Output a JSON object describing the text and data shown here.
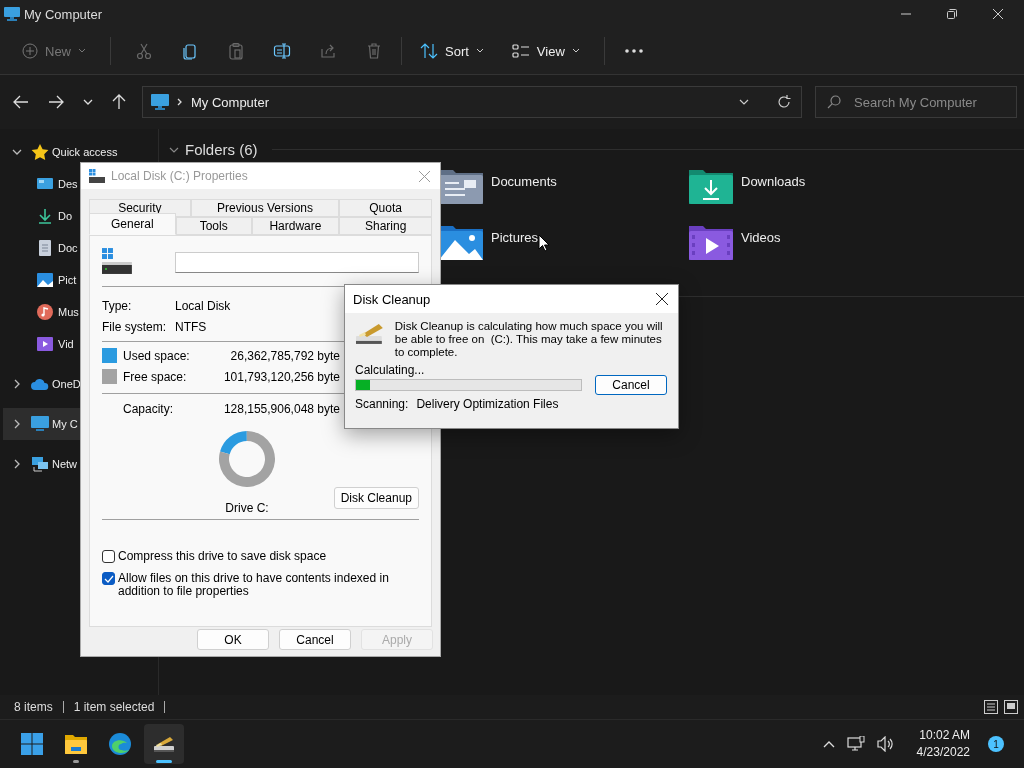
{
  "window": {
    "title": "My Computer"
  },
  "toolbar": {
    "new_button": {
      "label": "New",
      "disabled": true
    },
    "actions": [
      {
        "disabled": true
      },
      {
        "disabled": false
      },
      {
        "disabled": true
      },
      {
        "disabled": false
      },
      {
        "disabled": true
      },
      {
        "disabled": true
      }
    ],
    "sort": {
      "label": "Sort"
    },
    "view": {
      "label": "View"
    }
  },
  "address_bar": {
    "path": "My Computer"
  },
  "search": {
    "placeholder": "Search My Computer"
  },
  "sidebar": {
    "items": [
      {
        "label": "Quick access",
        "expanded": true,
        "selected": false,
        "children": [
          {
            "label": "Des",
            "selected": false
          },
          {
            "label": "Do",
            "selected": false
          },
          {
            "label": "Doc",
            "selected": false
          },
          {
            "label": "Pict",
            "selected": false
          },
          {
            "label": "Mus",
            "selected": false
          },
          {
            "label": "Vid",
            "selected": false
          }
        ]
      },
      {
        "label": "OneD",
        "expanded": false,
        "selected": false
      },
      {
        "label": "My C",
        "expanded": false,
        "selected": true
      },
      {
        "label": "Netw",
        "expanded": false,
        "selected": false
      }
    ]
  },
  "folders": {
    "heading": "Folders (6)",
    "expanded": true,
    "items": [
      {
        "label": "Documents"
      },
      {
        "label": "Downloads"
      },
      {
        "label": "Pictures"
      },
      {
        "label": "Videos"
      }
    ]
  },
  "status_bar": {
    "item_count": "8 items",
    "selection": "1 item selected"
  },
  "properties_dialog": {
    "title": "Local Disk (C:) Properties",
    "active": false,
    "tab_rows": [
      {
        "tabs": [
          {
            "label": "Security",
            "selected": false
          },
          {
            "label": "Previous Versions",
            "selected": false
          },
          {
            "label": "Quota",
            "selected": false
          }
        ]
      },
      {
        "tabs": [
          {
            "label": "General",
            "selected": true
          },
          {
            "label": "Tools",
            "selected": false
          },
          {
            "label": "Hardware",
            "selected": false
          },
          {
            "label": "Sharing",
            "selected": false
          }
        ]
      }
    ],
    "details": [
      {
        "label": "Type:",
        "value": "Local Disk"
      },
      {
        "label": "File system:",
        "value": "NTFS"
      }
    ],
    "space": [
      {
        "label": "Used space:",
        "value": "26,362,785,792 byte",
        "color": "#2b9be0"
      },
      {
        "label": "Free space:",
        "value": "101,793,120,256 byte",
        "color": "#a3a3a3"
      }
    ],
    "capacity": {
      "label": "Capacity:",
      "value": "128,155,906,048 byte"
    },
    "drive_chart": {
      "chart_data": {
        "type": "donut",
        "values": [
          20.57,
          79.43
        ]
      },
      "label": "Drive C:"
    },
    "cleanup_button": "Disk Cleanup",
    "options": [
      {
        "label": "Compress this drive to save disk space",
        "checked": false
      },
      {
        "label": "Allow files on this drive to have contents indexed in addition to file properties",
        "checked": true
      }
    ],
    "buttons": [
      {
        "label": "OK",
        "disabled": false
      },
      {
        "label": "Cancel",
        "disabled": false
      },
      {
        "label": "Apply",
        "disabled": true
      }
    ]
  },
  "cleanup_dialog": {
    "title": "Disk Cleanup",
    "message": "Disk Cleanup is calculating how much space you will be able to free on  (C:). This may take a few minutes to complete.",
    "status": "Calculating...",
    "level": 0.06,
    "cancel_button": "Cancel",
    "scanning_label": "Scanning:",
    "scanning_item": "Delivery Optimization Files"
  },
  "taskbar": {
    "apps": [
      {
        "running": false,
        "selected": false
      },
      {
        "running": true,
        "selected": false
      },
      {
        "running": false,
        "selected": false
      },
      {
        "running": true,
        "selected": true
      }
    ],
    "time": "10:02 AM",
    "date": "4/23/2022",
    "notification_count": "1"
  }
}
